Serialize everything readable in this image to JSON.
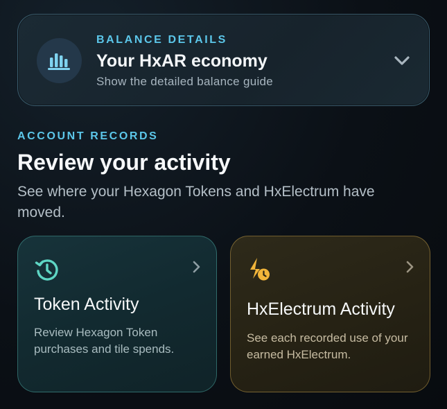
{
  "balance": {
    "eyebrow": "BALANCE DETAILS",
    "title": "Your HxAR economy",
    "subtitle": "Show the detailed balance guide",
    "icon": "bar-chart-icon",
    "toggle_icon": "chevron-down-icon"
  },
  "records": {
    "eyebrow": "ACCOUNT RECORDS",
    "title": "Review your activity",
    "description": "See where your Hexagon Tokens and HxElectrum have moved."
  },
  "tiles": [
    {
      "title": "Token Activity",
      "description": "Review Hexagon Token purchases and tile spends.",
      "icon": "history-icon",
      "accent": "#5ed6c4"
    },
    {
      "title": "HxElectrum Activity",
      "description": "See each recorded use of your earned HxElectrum.",
      "icon": "bolt-clock-icon",
      "accent": "#f2b53a"
    }
  ],
  "colors": {
    "accent_cyan": "#5cc7ea",
    "accent_teal": "#5ed6c4",
    "accent_amber": "#f2b53a"
  }
}
